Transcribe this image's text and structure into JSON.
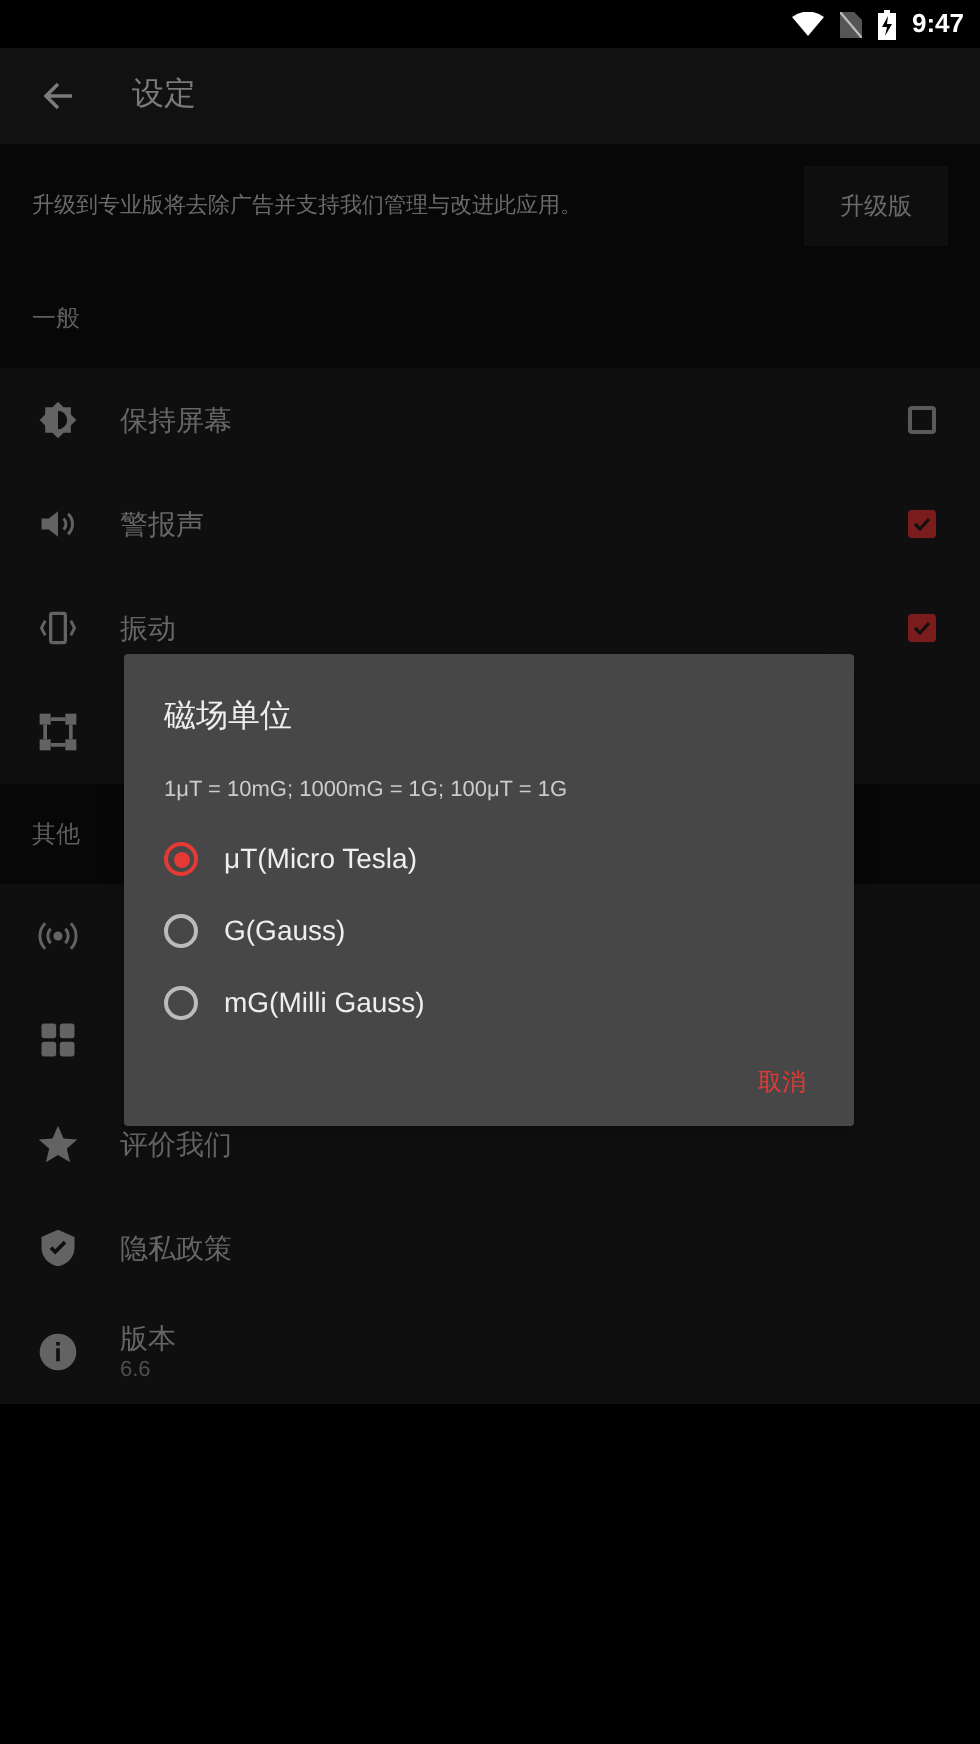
{
  "status_bar": {
    "time": "9:47"
  },
  "toolbar": {
    "title": "设定"
  },
  "upgrade": {
    "message": "升级到专业版将去除广告并支持我们管理与改进此应用。",
    "button": "升级版"
  },
  "sections": [
    {
      "header": "一般",
      "items": [
        {
          "label": "保持屏幕",
          "kind": "checkbox",
          "checked": false
        },
        {
          "label": "警报声",
          "kind": "checkbox",
          "checked": true
        },
        {
          "label": "振动",
          "kind": "checkbox",
          "checked": true
        },
        {
          "kind": "plain"
        }
      ]
    },
    {
      "header": "其他",
      "items": [
        {
          "kind": "plain"
        },
        {
          "kind": "plain"
        },
        {
          "label": "评价我们",
          "kind": "plain"
        },
        {
          "label": "隐私政策",
          "kind": "plain"
        },
        {
          "label": "版本",
          "subtitle": "6.6",
          "kind": "plain"
        }
      ]
    }
  ],
  "dialog": {
    "title": "磁场单位",
    "note": "1μT = 10mG; 1000mG = 1G; 100μT = 1G",
    "options": [
      {
        "label": "μT(Micro Tesla)",
        "selected": true
      },
      {
        "label": "G(Gauss)",
        "selected": false
      },
      {
        "label": "mG(Milli Gauss)",
        "selected": false
      }
    ],
    "cancel": "取消"
  }
}
